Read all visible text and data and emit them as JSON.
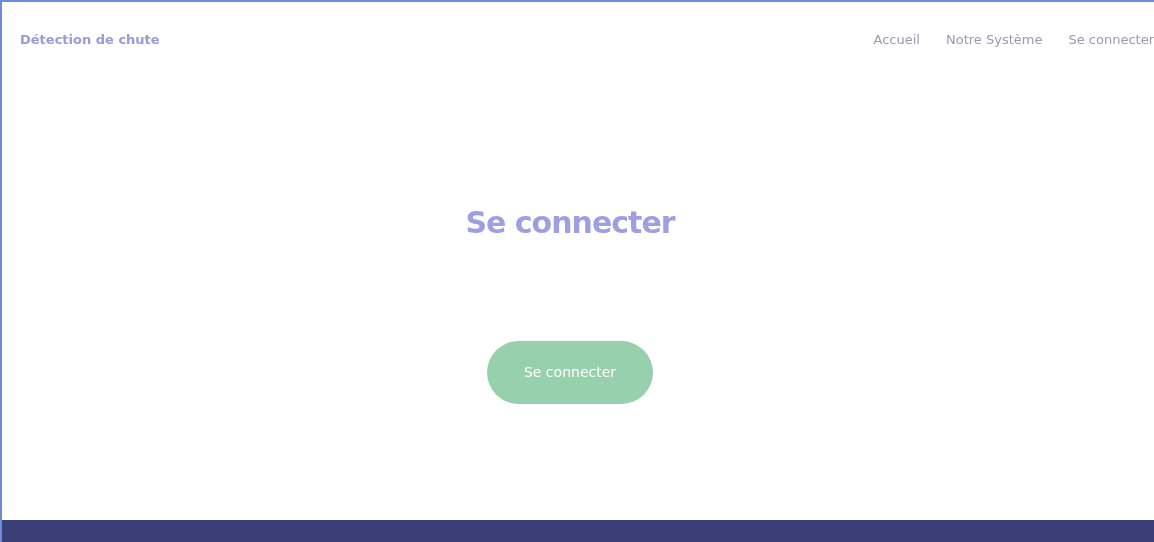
{
  "navbar": {
    "brand": "Détection de chute",
    "links": [
      {
        "label": "Accueil"
      },
      {
        "label": "Notre Système"
      },
      {
        "label": "Se connecter"
      }
    ]
  },
  "main": {
    "title": "Se connecter",
    "button": "Se connecter"
  }
}
